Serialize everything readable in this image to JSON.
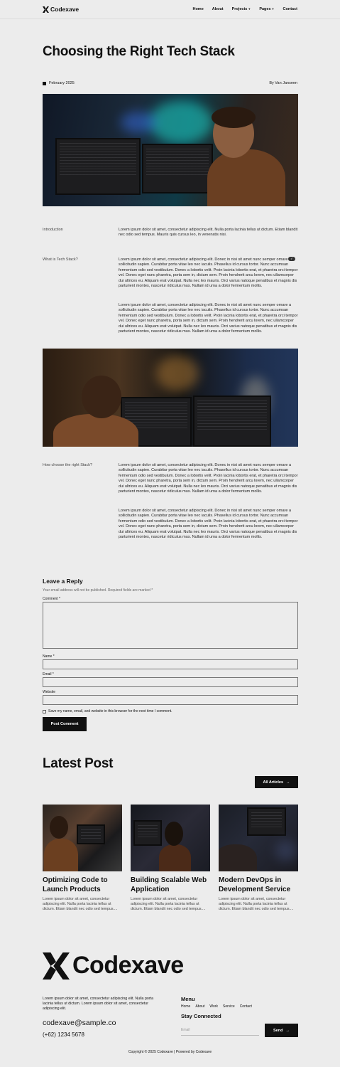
{
  "brand": {
    "name": "Codexave"
  },
  "nav": {
    "home": "Home",
    "about": "About",
    "projects": "Projects",
    "pages": "Pages",
    "contact": "Contact"
  },
  "post": {
    "title": "Choosing the Right Tech Stack",
    "date": "February 2025",
    "author": "By Van Janseen",
    "sections": [
      {
        "label": "Introduction",
        "paragraphs": [
          "Lorem ipsum dolor sit amet, consectetur adipiscing elit. Nulla porta lacinia tellus ut dictum. Etiam blandit nec odio sed tempus. Mauris quis cursus leo, in venenatis nisi."
        ]
      },
      {
        "label": "What is Tech Stack?",
        "paragraphs": [
          "Lorem ipsum dolor sit amet, consectetur adipiscing elit. Donec in nisi sit amet nunc semper ornare a sollicitudin sapien. Curabitur porta vitae leo nec iaculis. Phasellus id cursus tortor. Nunc accumsan fermentum odio sed vestibulum. Donec a lobortis velit. Proin lacinia lobortis erat, et pharetra orci tempor vel. Donec eget nunc pharetra, porta sem in, dictum sem. Proin hendrerit arcu lorem, nec ullamcorper dui ultrices eu. Aliquam erat volutpat. Nulla nec leo mauris. Orci varius natoque penatibus et magnis dis parturient montes, nascetur ridiculus mus. Nullam id urna a dolor fermentum mollis.",
          "Lorem ipsum dolor sit amet, consectetur adipiscing elit. Donec in nisi sit amet nunc semper ornare a sollicitudin sapien. Curabitur porta vitae leo nec iaculis. Phasellus id cursus tortor. Nunc accumsan fermentum odio sed vestibulum. Donec a lobortis velit. Proin lacinia lobortis erat, et pharetra orci tempor vel. Donec eget nunc pharetra, porta sem in, dictum sem. Proin hendrerit arcu lorem, nec ullamcorper dui ultrices eu. Aliquam erat volutpat. Nulla nec leo mauris. Orci varius natoque penatibus et magnis dis parturient montes, nascetur ridiculus mus. Nullam id urna a dolor fermentum mollis."
        ]
      },
      {
        "label": "How choose the right Stack?",
        "paragraphs": [
          "Lorem ipsum dolor sit amet, consectetur adipiscing elit. Donec in nisi sit amet nunc semper ornare a sollicitudin sapien. Curabitur porta vitae leo nec iaculis. Phasellus id cursus tortor. Nunc accumsan fermentum odio sed vestibulum. Donec a lobortis velit. Proin lacinia lobortis erat, et pharetra orci tempor vel. Donec eget nunc pharetra, porta sem in, dictum sem. Proin hendrerit arcu lorem, nec ullamcorper dui ultrices eu. Aliquam erat volutpat. Nulla nec leo mauris. Orci varius natoque penatibus et magnis dis parturient montes, nascetur ridiculus mus. Nullam id urna a dolor fermentum mollis.",
          "Lorem ipsum dolor sit amet, consectetur adipiscing elit. Donec in nisi sit amet nunc semper ornare a sollicitudin sapien. Curabitur porta vitae leo nec iaculis. Phasellus id cursus tortor. Nunc accumsan fermentum odio sed vestibulum. Donec a lobortis velit. Proin lacinia lobortis erat, et pharetra orci tempor vel. Donec eget nunc pharetra, porta sem in, dictum sem. Proin hendrerit arcu lorem, nec ullamcorper dui ultrices eu. Aliquam erat volutpat. Nulla nec leo mauris. Orci varius natoque penatibus et magnis dis parturient montes, nascetur ridiculus mus. Nullam id urna a dolor fermentum mollis."
        ]
      }
    ]
  },
  "reply": {
    "title": "Leave a Reply",
    "note": "Your email address will not be published. Required fields are marked *",
    "comment_label": "Comment *",
    "name_label": "Name *",
    "email_label": "Email *",
    "website_label": "Website",
    "save_label": "Save my name, email, and website in this browser for the next time I comment.",
    "submit_label": "Post Comment"
  },
  "latest": {
    "title": "Latest Post",
    "all_label": "All Articles",
    "cards": [
      {
        "title": "Optimizing Code to Launch Products",
        "text": "Lorem ipsum dolor sit amet, consectetur adipiscing elit. Nulla porta lacinia tellus ut dictum. Etiam blandit nec odio sed tempus...."
      },
      {
        "title": "Building Scalable Web Application",
        "text": "Lorem ipsum dolor sit amet, consectetur adipiscing elit. Nulla porta lacinia tellus ut dictum. Etiam blandit nec odio sed tempus...."
      },
      {
        "title": "Modern DevOps in Development Service",
        "text": "Lorem ipsum dolor sit amet, consectetur adipiscing elit. Nulla porta lacinia tellus ut dictum. Etiam blandit nec odio sed tempus...."
      }
    ]
  },
  "footer": {
    "text": "Lorem ipsum dolor sit amet, consectetur adipiscing elit. Nulla porta lacinia tellus ut dictum. Lorem ipsum dolor sit amet, consectetur adipiscing elit.",
    "email": "codexave@sample.co",
    "phone": "(+62) 1234 5678",
    "menu_title": "Menu",
    "menu": [
      "Home",
      "About",
      "Work",
      "Service",
      "Contact"
    ],
    "stay_title": "Stay Connected",
    "email_placeholder": "Email",
    "send_label": "Send",
    "copyright": "Copyright © 2025 Codexave | Powered by Codexave"
  },
  "icons": {
    "logo": "codexave-logo-icon",
    "arrow": "arrow-right-icon",
    "caret": "chevron-down-icon"
  },
  "colors": {
    "background": "#ececec",
    "ink": "#111111",
    "button": "#111111"
  }
}
